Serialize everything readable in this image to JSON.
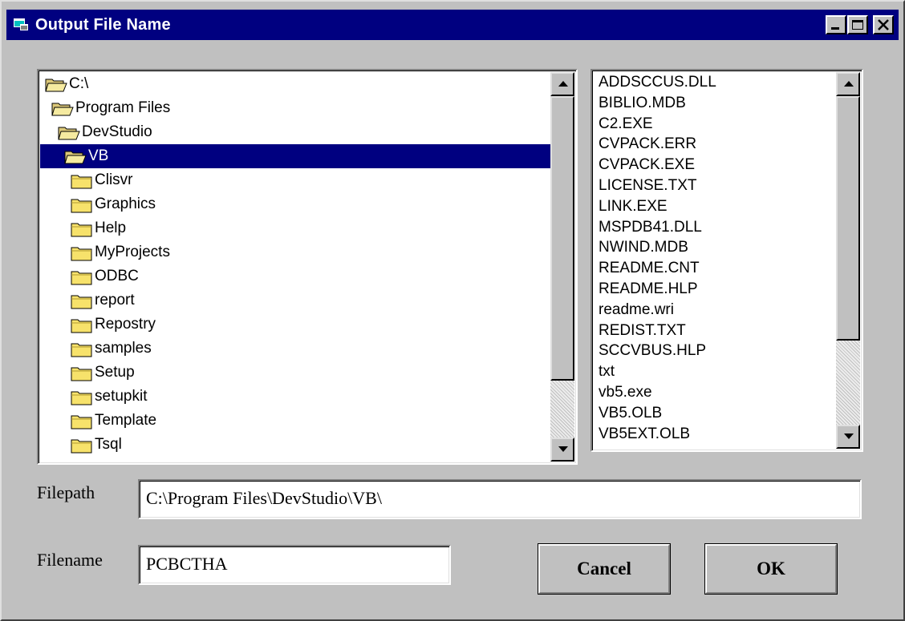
{
  "window": {
    "title": "Output File Name",
    "controls": [
      "minimize-icon",
      "maximize-icon",
      "close-icon"
    ]
  },
  "folder_tree": {
    "items": [
      {
        "label": "C:\\",
        "state": "open",
        "selected": false
      },
      {
        "label": "Program Files",
        "state": "open",
        "selected": false
      },
      {
        "label": "DevStudio",
        "state": "open",
        "selected": false
      },
      {
        "label": "VB",
        "state": "open",
        "selected": true
      },
      {
        "label": "Clisvr",
        "state": "closed",
        "selected": false
      },
      {
        "label": "Graphics",
        "state": "closed",
        "selected": false
      },
      {
        "label": "Help",
        "state": "closed",
        "selected": false
      },
      {
        "label": "MyProjects",
        "state": "closed",
        "selected": false
      },
      {
        "label": "ODBC",
        "state": "closed",
        "selected": false
      },
      {
        "label": "report",
        "state": "closed",
        "selected": false
      },
      {
        "label": "Repostry",
        "state": "closed",
        "selected": false
      },
      {
        "label": "samples",
        "state": "closed",
        "selected": false
      },
      {
        "label": "Setup",
        "state": "closed",
        "selected": false
      },
      {
        "label": "setupkit",
        "state": "closed",
        "selected": false
      },
      {
        "label": "Template",
        "state": "closed",
        "selected": false
      },
      {
        "label": "Tsql",
        "state": "closed",
        "selected": false
      }
    ]
  },
  "file_list": {
    "items": [
      "ADDSCCUS.DLL",
      "BIBLIO.MDB",
      "C2.EXE",
      "CVPACK.ERR",
      "CVPACK.EXE",
      "LICENSE.TXT",
      "LINK.EXE",
      "MSPDB41.DLL",
      "NWIND.MDB",
      "README.CNT",
      "README.HLP",
      "readme.wri",
      "REDIST.TXT",
      "SCCVBUS.HLP",
      "txt",
      "vb5.exe",
      "VB5.OLB",
      "VB5EXT.OLB"
    ]
  },
  "form": {
    "filepath_label": "Filepath",
    "filepath_value": "C:\\Program Files\\DevStudio\\VB\\",
    "filename_label": "Filename",
    "filename_value": "PCBCTHA"
  },
  "buttons": {
    "cancel_label": "Cancel",
    "ok_label": "OK"
  },
  "colors": {
    "titlebar": "#000080",
    "face": "#c0c0c0",
    "selection": "#000080"
  }
}
